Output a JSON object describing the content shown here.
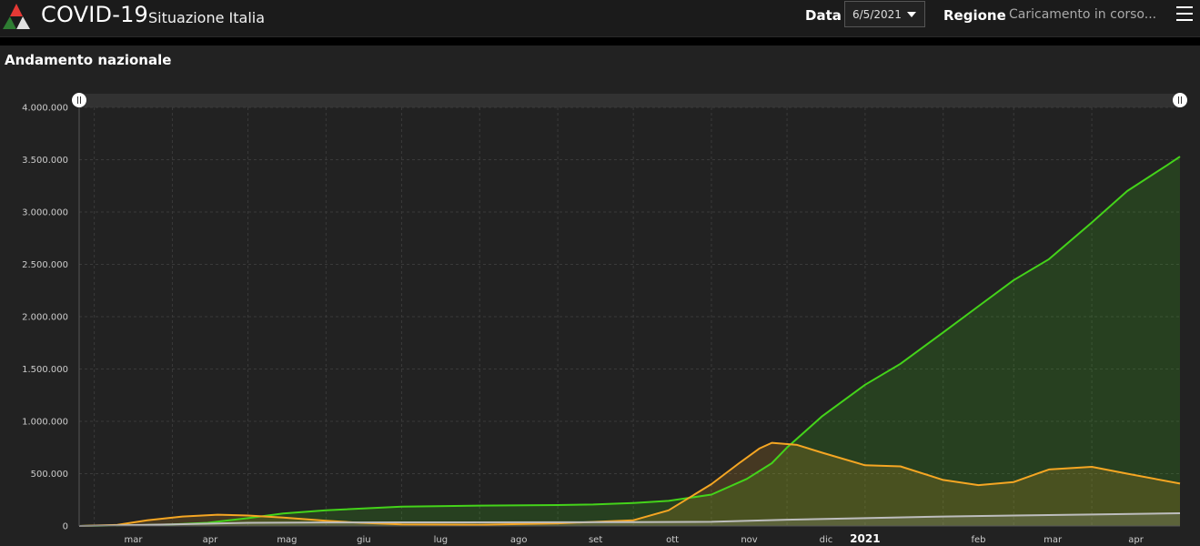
{
  "header": {
    "title": "COVID-19",
    "subtitle": "Situazione Italia",
    "data_label": "Data",
    "date_value": "6/5/2021",
    "region_label": "Regione",
    "region_status": "Caricamento in corso..."
  },
  "section_title": "Andamento nazionale",
  "chart_data": {
    "type": "area",
    "ylim": [
      0,
      4000000
    ],
    "y_ticks": [
      "0",
      "500.000",
      "1.000.000",
      "1.500.000",
      "2.000.000",
      "2.500.000",
      "3.000.000",
      "3.500.000",
      "4.000.000"
    ],
    "y_tick_values": [
      0,
      500000,
      1000000,
      1500000,
      2000000,
      2500000,
      3000000,
      3500000,
      4000000
    ],
    "x_tick_labels": [
      "mar",
      "apr",
      "mag",
      "giu",
      "lug",
      "ago",
      "set",
      "ott",
      "nov",
      "dic",
      "2021",
      "feb",
      "mar",
      "apr"
    ],
    "x_tick_dates": [
      "2020-03-01",
      "2020-04-01",
      "2020-05-01",
      "2020-06-01",
      "2020-07-01",
      "2020-08-01",
      "2020-09-01",
      "2020-10-01",
      "2020-11-01",
      "2020-12-01",
      "2021-01-01",
      "2021-02-01",
      "2021-03-01",
      "2021-04-01"
    ],
    "x_range": [
      "2020-02-24",
      "2021-05-06"
    ],
    "grid": true,
    "colors": {
      "green": "#44d31a",
      "orange": "#f5a623",
      "gray": "#bdbdbd"
    },
    "series": [
      {
        "color": "#44d31a",
        "points": [
          [
            "2020-02-24",
            0
          ],
          [
            "2020-03-15",
            5000
          ],
          [
            "2020-04-01",
            15000
          ],
          [
            "2020-04-15",
            30000
          ],
          [
            "2020-05-01",
            75000
          ],
          [
            "2020-05-15",
            120000
          ],
          [
            "2020-06-01",
            150000
          ],
          [
            "2020-07-01",
            185000
          ],
          [
            "2020-08-01",
            195000
          ],
          [
            "2020-09-01",
            200000
          ],
          [
            "2020-09-15",
            205000
          ],
          [
            "2020-10-01",
            220000
          ],
          [
            "2020-10-15",
            240000
          ],
          [
            "2020-11-01",
            300000
          ],
          [
            "2020-11-15",
            450000
          ],
          [
            "2020-11-25",
            600000
          ],
          [
            "2020-12-01",
            750000
          ],
          [
            "2020-12-15",
            1050000
          ],
          [
            "2021-01-01",
            1350000
          ],
          [
            "2021-01-15",
            1550000
          ],
          [
            "2021-02-01",
            1850000
          ],
          [
            "2021-02-15",
            2100000
          ],
          [
            "2021-03-01",
            2350000
          ],
          [
            "2021-03-15",
            2550000
          ],
          [
            "2021-04-01",
            2900000
          ],
          [
            "2021-04-15",
            3200000
          ],
          [
            "2021-05-01",
            3450000
          ],
          [
            "2021-05-06",
            3530000
          ]
        ]
      },
      {
        "color": "#f5a623",
        "points": [
          [
            "2020-02-24",
            0
          ],
          [
            "2020-03-10",
            10000
          ],
          [
            "2020-03-22",
            55000
          ],
          [
            "2020-04-05",
            90000
          ],
          [
            "2020-04-19",
            108000
          ],
          [
            "2020-05-01",
            100000
          ],
          [
            "2020-05-15",
            80000
          ],
          [
            "2020-06-01",
            50000
          ],
          [
            "2020-06-15",
            30000
          ],
          [
            "2020-07-01",
            15000
          ],
          [
            "2020-08-01",
            12000
          ],
          [
            "2020-09-01",
            25000
          ],
          [
            "2020-10-01",
            55000
          ],
          [
            "2020-10-15",
            150000
          ],
          [
            "2020-11-01",
            400000
          ],
          [
            "2020-11-12",
            600000
          ],
          [
            "2020-11-20",
            740000
          ],
          [
            "2020-11-25",
            795000
          ],
          [
            "2020-12-05",
            775000
          ],
          [
            "2020-12-15",
            700000
          ],
          [
            "2021-01-01",
            580000
          ],
          [
            "2021-01-15",
            570000
          ],
          [
            "2021-02-01",
            440000
          ],
          [
            "2021-02-15",
            390000
          ],
          [
            "2021-03-01",
            420000
          ],
          [
            "2021-03-15",
            540000
          ],
          [
            "2021-04-01",
            565000
          ],
          [
            "2021-04-15",
            500000
          ],
          [
            "2021-05-06",
            405000
          ]
        ]
      },
      {
        "color": "#bdbdbd",
        "points": [
          [
            "2020-02-24",
            0
          ],
          [
            "2020-04-01",
            15000
          ],
          [
            "2020-05-01",
            30000
          ],
          [
            "2020-06-01",
            34000
          ],
          [
            "2020-07-01",
            35000
          ],
          [
            "2020-09-01",
            36000
          ],
          [
            "2020-10-01",
            37000
          ],
          [
            "2020-11-01",
            40000
          ],
          [
            "2020-12-01",
            60000
          ],
          [
            "2021-01-01",
            75000
          ],
          [
            "2021-02-01",
            90000
          ],
          [
            "2021-03-01",
            100000
          ],
          [
            "2021-04-01",
            110000
          ],
          [
            "2021-05-06",
            122000
          ]
        ]
      }
    ]
  }
}
